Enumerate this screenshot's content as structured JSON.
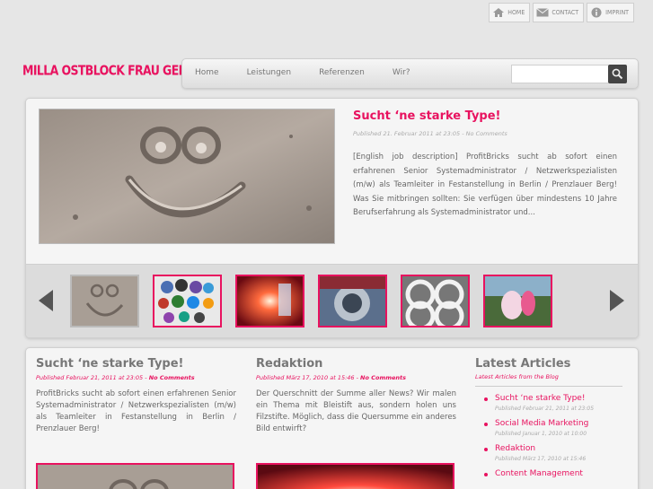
{
  "toplinks": [
    {
      "label": "Home",
      "icon": "home-icon"
    },
    {
      "label": "Contact",
      "icon": "mail-icon"
    },
    {
      "label": "Imprint",
      "icon": "info-icon"
    }
  ],
  "logo": "MILLA OSTBLOCK FRAU GEDNKA",
  "nav": [
    "Home",
    "Leistungen",
    "Referenzen",
    "Wir?"
  ],
  "search": {
    "placeholder": "",
    "icon": "search-icon"
  },
  "feature": {
    "title": "Sucht ‘ne starke Type!",
    "meta": "Published 21. Februar 2011 at 23:05 - No Comments",
    "text": "[English job description] ProfitBricks sucht ab sofort einen erfahrenen Senior Systemadministrator / Netzwerkspezialisten (m/w) als Teamleiter in Festanstellung in Berlin / Prenzlauer Berg! Was Sie mitbringen sollten: Sie verfügen über mindestens 10 Jahre Berufserfahrung als Systemadministrator und..."
  },
  "thumbs": [
    "sand-smiley",
    "buttons",
    "red-lights",
    "car-chrome",
    "abstract-rings",
    "dancers"
  ],
  "posts": [
    {
      "title": "Sucht ‘ne starke Type!",
      "meta_date": "Published Februar 21, 2011 at 23:05",
      "meta_comments": "No Comments",
      "text": "ProfitBricks sucht ab sofort einen erfahrenen Senior Systemadministrator / Netzwerkspezialisten (m/w) als Teamleiter in Festanstellung in Berlin / Prenzlauer Berg!"
    },
    {
      "title": "Redaktion",
      "meta_date": "Published März 17, 2010 at 15:46",
      "meta_comments": "No Comments",
      "text": "Der Querschnitt der Summe aller News? Wir malen ein Thema mit Bleistift aus, sondern holen uns Filzstifte. Möglich, dass die Quersumme ein anderes Bild entwirft?"
    }
  ],
  "latest": {
    "title": "Latest Articles",
    "subtitle": "Latest Articles from the Blog",
    "items": [
      {
        "title": "Sucht ‘ne starke Type!",
        "meta": "Published Februar 21, 2011 at 23:05"
      },
      {
        "title": "Social Media Marketing",
        "meta": "Published Januar 1, 2010 at 10:00"
      },
      {
        "title": "Redaktion",
        "meta": "Published März 17, 2010 at 15:46"
      },
      {
        "title": "Content Management",
        "meta": ""
      }
    ]
  },
  "colors": {
    "accent": "#e8125f",
    "background": "#e6e6e6",
    "panel": "#f5f5f5"
  }
}
